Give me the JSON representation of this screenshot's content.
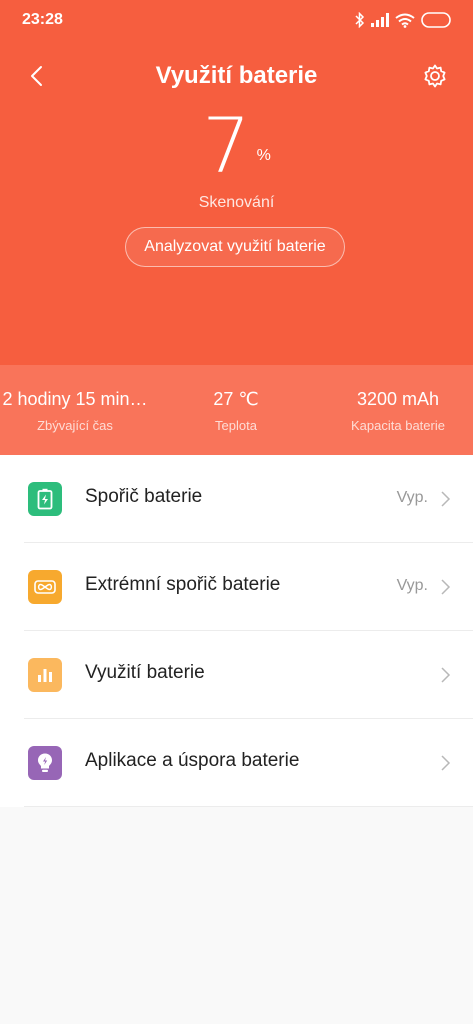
{
  "status_bar": {
    "time": "23:28"
  },
  "header": {
    "title": "Využití baterie"
  },
  "battery": {
    "percent": "7",
    "percent_sign": "%",
    "scan_label": "Skenování",
    "analyze_button": "Analyzovat využití baterie"
  },
  "stats": [
    {
      "value": "2 hodiny 15 min…",
      "label": "Zbývající čas"
    },
    {
      "value": "27 ℃",
      "label": "Teplota"
    },
    {
      "value": "3200 mAh",
      "label": "Kapacita baterie"
    }
  ],
  "menu": [
    {
      "label": "Spořič baterie",
      "status": "Vyp.",
      "icon": "battery-saver-icon",
      "color": "#2dbd7c"
    },
    {
      "label": "Extrémní spořič baterie",
      "status": "Vyp.",
      "icon": "infinity-icon",
      "color": "#f7a92e"
    },
    {
      "label": "Využití baterie",
      "status": "",
      "icon": "bar-chart-icon",
      "color": "#fbb85e"
    },
    {
      "label": "Aplikace a úspora baterie",
      "status": "",
      "icon": "lightbulb-icon",
      "color": "#9766b6"
    }
  ],
  "colors": {
    "hero": "#f65e3f",
    "stats_band": "#f9745a"
  }
}
